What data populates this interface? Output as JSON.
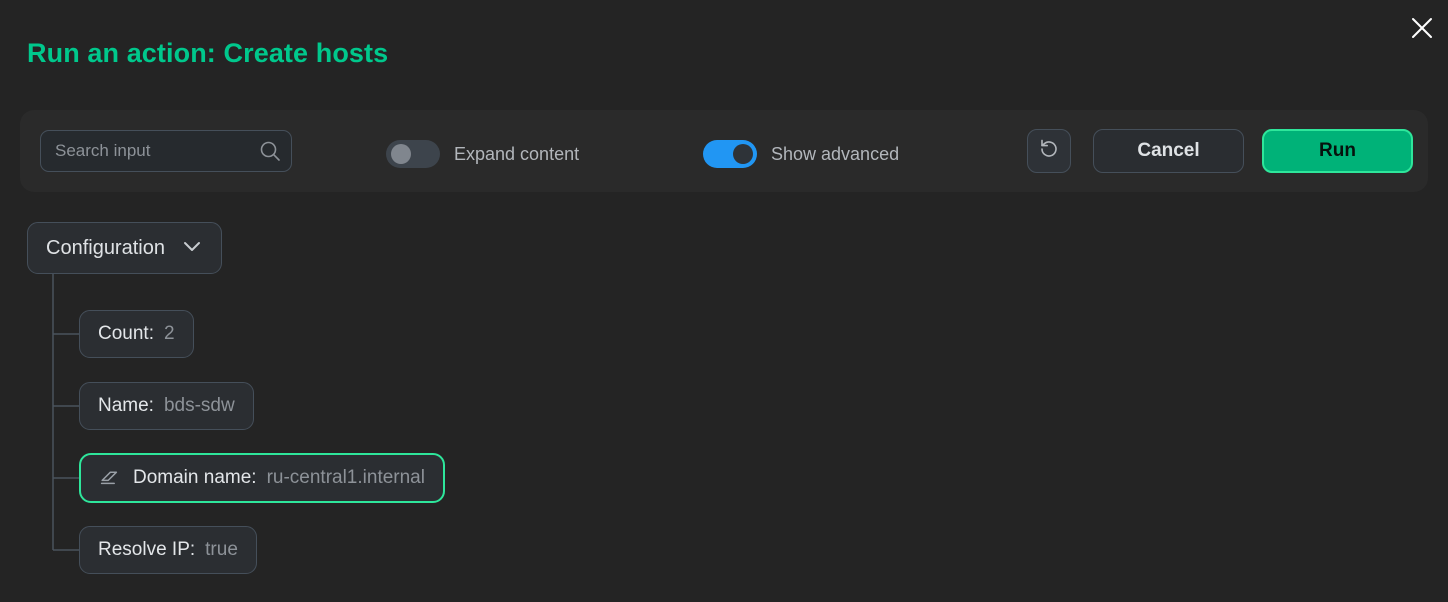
{
  "window": {
    "title": "Run an action: Create hosts",
    "close_icon": "close-icon",
    "background": "#242424",
    "accent": "#00c88c"
  },
  "toolbar": {
    "search": {
      "placeholder": "Search input",
      "value": "",
      "icon": "search-icon"
    },
    "toggles": [
      {
        "label": "Expand content",
        "state": "off",
        "track_color": "#3d444c",
        "knob_color": "#80868e"
      },
      {
        "label": "Show advanced",
        "state": "on",
        "track_color": "#2196f3",
        "knob_color": "#2e3338"
      }
    ],
    "reset_icon": "reset-icon",
    "cancel_label": "Cancel",
    "run_label": "Run",
    "run_color": "#00b278",
    "run_border": "#2ee69b"
  },
  "tree": {
    "root": {
      "label": "Configuration",
      "chevron_icon": "chevron-down-icon",
      "expanded": true
    },
    "nodes": [
      {
        "key": "Count:",
        "value": "2",
        "icon": null,
        "selected": false
      },
      {
        "key": "Name:",
        "value": "bds-sdw",
        "icon": null,
        "selected": false
      },
      {
        "key": "Domain name:",
        "value": "ru-central1.internal",
        "icon": "eraser-icon",
        "selected": true
      },
      {
        "key": "Resolve IP:",
        "value": "true",
        "icon": null,
        "selected": false
      }
    ]
  }
}
